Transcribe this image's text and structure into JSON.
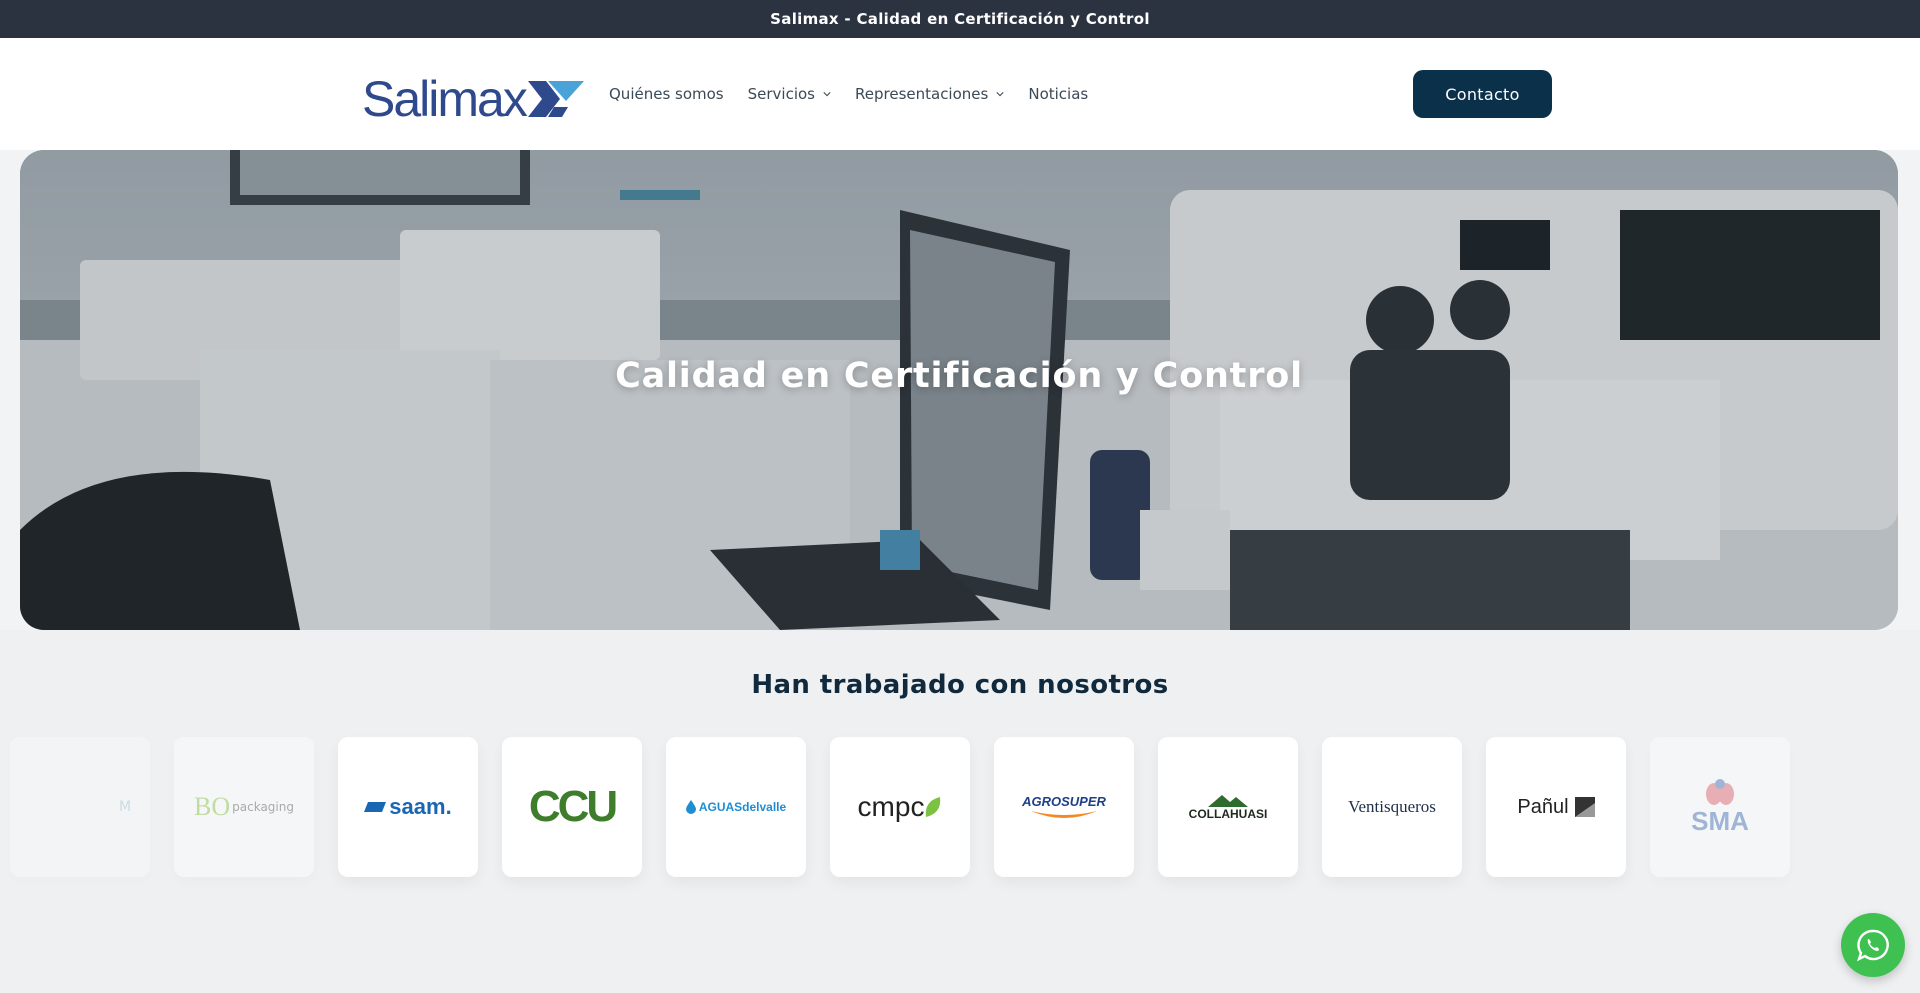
{
  "announcement": {
    "text": "Salimax - Calidad en Certificación y Control"
  },
  "header": {
    "logo_text": "Salimax",
    "nav": [
      {
        "label": "Quiénes somos",
        "has_dropdown": false
      },
      {
        "label": "Servicios",
        "has_dropdown": true
      },
      {
        "label": "Representaciones",
        "has_dropdown": true
      },
      {
        "label": "Noticias",
        "has_dropdown": false
      }
    ],
    "contact_label": "Contacto"
  },
  "hero": {
    "title": "Calidad en Certificación y Control"
  },
  "partners": {
    "title": "Han trabajado con nosotros",
    "logos": [
      {
        "name": "BO packaging",
        "text": "packaging"
      },
      {
        "name": "saam",
        "text": "saam."
      },
      {
        "name": "CCU",
        "text": "CCU"
      },
      {
        "name": "Aguas del Valle",
        "text": "AGUASdelvalle"
      },
      {
        "name": "cmpc",
        "text": "cmpc"
      },
      {
        "name": "Agrosuper",
        "text": "AGROSUPER"
      },
      {
        "name": "Collahuasi",
        "text": "COLLAHUASI"
      },
      {
        "name": "Ventisqueros",
        "text": "Ventisqueros"
      },
      {
        "name": "Pañul",
        "text": "Pañul"
      },
      {
        "name": "SMA",
        "text": "SMA"
      }
    ]
  },
  "colors": {
    "announcement_bg": "#2c3340",
    "primary": "#0b3049",
    "logo_blue": "#2f4a8c",
    "whatsapp": "#3fc151"
  },
  "icons": {
    "dropdown": "chevron-down-icon",
    "whatsapp": "whatsapp-icon"
  }
}
